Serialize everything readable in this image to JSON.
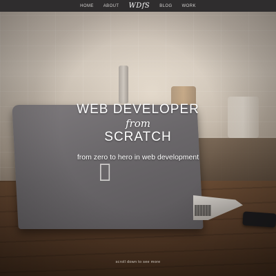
{
  "nav": {
    "items": [
      {
        "label": "HOME"
      },
      {
        "label": "ABOUT"
      },
      {
        "label": "WDfS"
      },
      {
        "label": "BLOG"
      },
      {
        "label": "WORK"
      }
    ]
  },
  "hero": {
    "line1": "WEB DEVELOPER",
    "line2": "from",
    "line3": "SCRATCH",
    "tagline": "from zero to hero in web development"
  },
  "scroll_hint": "scroll down to see more",
  "background": {
    "laptop_logo_icon": "apple-icon",
    "colors": {
      "nav": "#2f2d2e",
      "text": "#ffffff"
    }
  }
}
